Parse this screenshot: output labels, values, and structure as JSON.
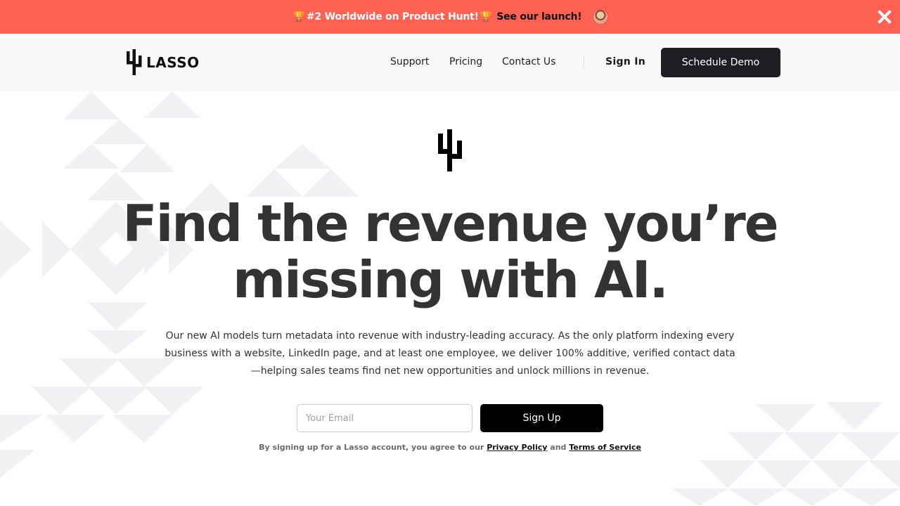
{
  "banner": {
    "trophy": "🏆",
    "text": "#2 Worldwide on Product Hunt!",
    "link_text": "See our launch!",
    "avatar_icon": "avatar-icon",
    "close_icon": "close-icon",
    "background": "#ff6153"
  },
  "nav": {
    "logo_text": "LASSO",
    "links": [
      "Support",
      "Pricing",
      "Contact Us"
    ],
    "sign_in": "Sign In",
    "cta": "Schedule Demo"
  },
  "hero": {
    "title_line1": "Find the revenue you’re",
    "title_line2": "missing with AI.",
    "subtitle": "Our new AI models turn metadata into revenue with industry-leading accuracy. As the only platform indexing every business with a website, LinkedIn page, and at least one employee, we deliver 100% additive, verified contact data—helping sales teams find net new opportunities and unlock millions in revenue.",
    "email_placeholder": "Your Email",
    "signup_label": "Sign Up",
    "terms_prefix": "By signing up for a Lasso account, you agree to our",
    "privacy_label": "Privacy Policy",
    "terms_and": "and",
    "tos_label": "Terms of Service"
  },
  "colors": {
    "accent": "#ff6153",
    "dark_button": "#1d1e22",
    "text": "#333333"
  }
}
